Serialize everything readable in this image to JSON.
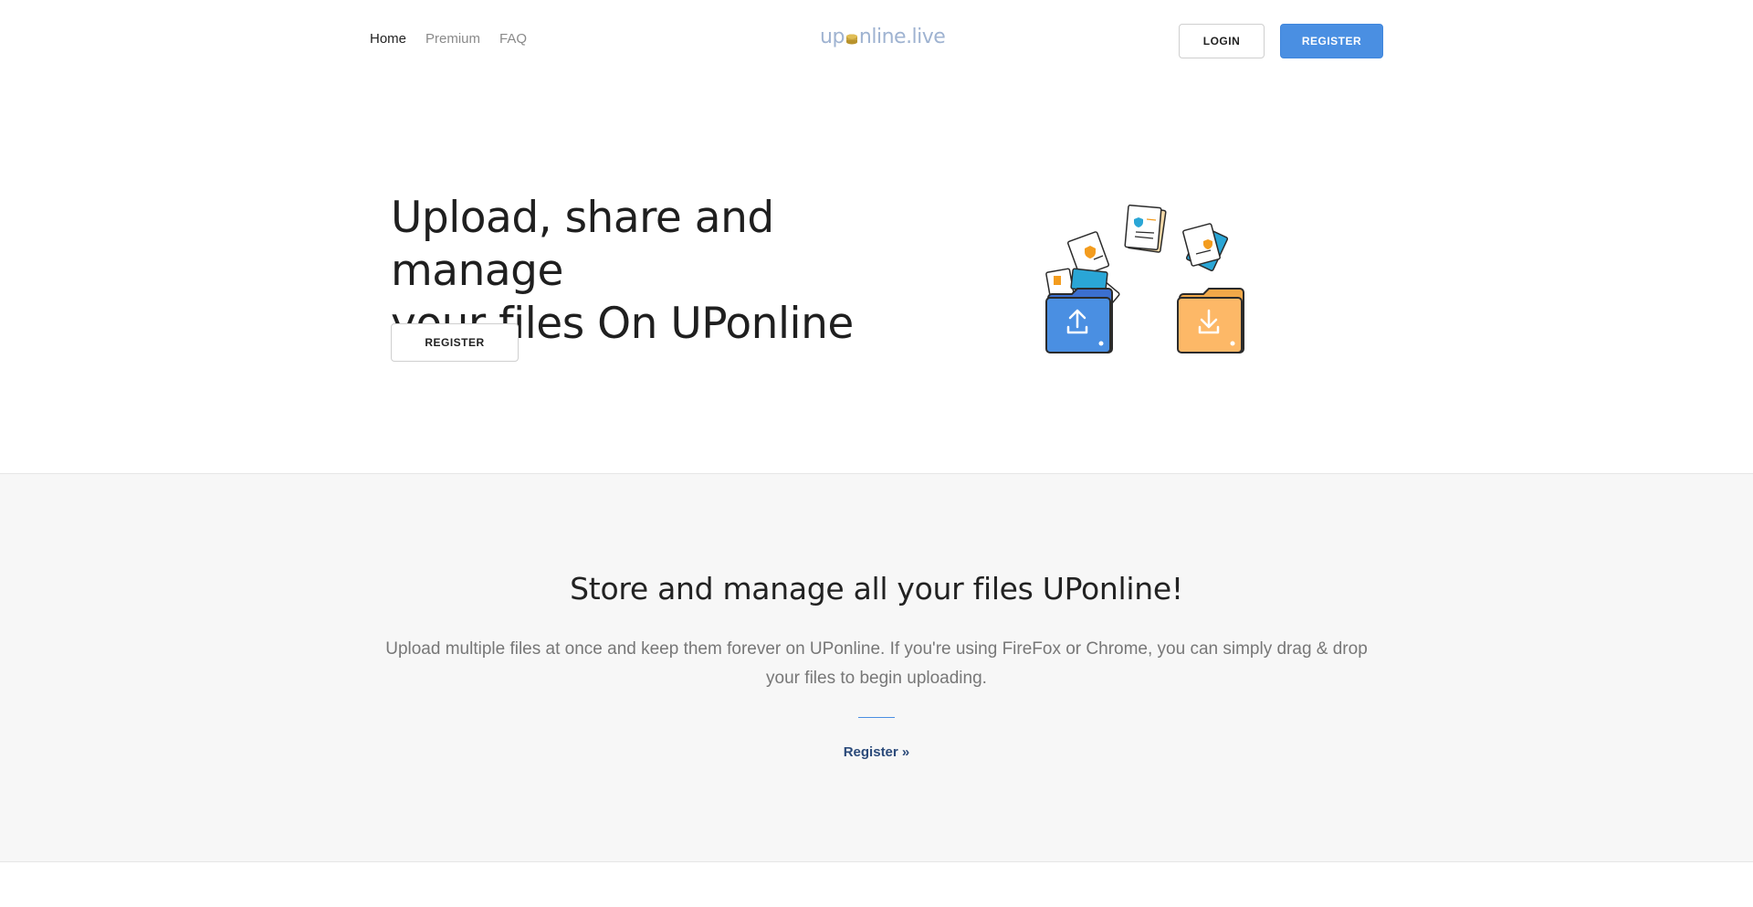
{
  "nav": {
    "items": [
      {
        "label": "Home",
        "active": true
      },
      {
        "label": "Premium",
        "active": false
      },
      {
        "label": "FAQ",
        "active": false
      }
    ]
  },
  "logo": {
    "text_before": "up",
    "text_after": "nline.live"
  },
  "header": {
    "login_label": "LOGIN",
    "register_label": "REGISTER"
  },
  "hero": {
    "title_line1": "Upload, share and manage",
    "title_line2": "your files On UPonline",
    "register_label": "REGISTER"
  },
  "features": {
    "heading": "Store and manage all your files UPonline!",
    "description": "Upload multiple files at once and keep them forever on UPonline. If you're using FireFox or Chrome, you can simply drag & drop your files to begin uploading.",
    "link_label": "Register »"
  },
  "colors": {
    "accent": "#4a8fe2",
    "upload_folder": "#4a8fe2",
    "download_folder": "#fdb867"
  }
}
